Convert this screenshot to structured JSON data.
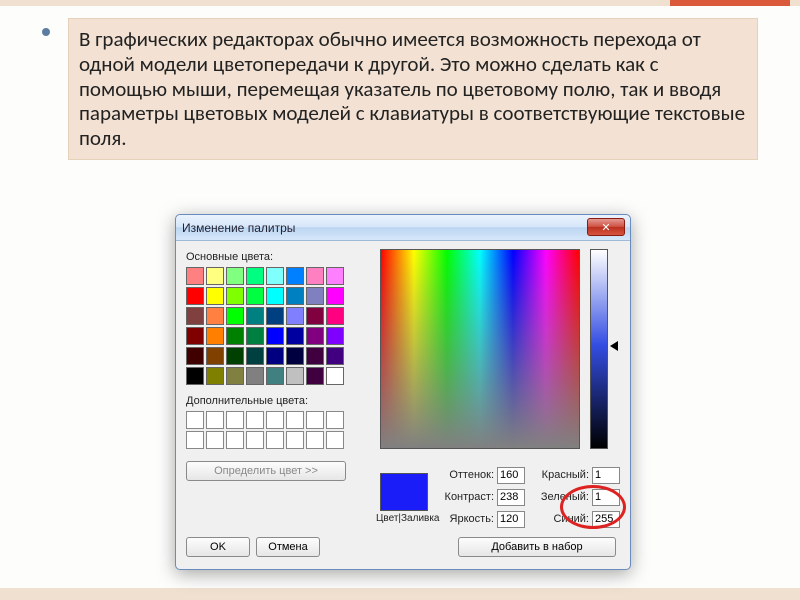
{
  "slide": {
    "paragraph": "В графических редакторах обычно имеется возможность перехода от одной модели цветопередачи к другой. Это можно сделать как с помощью мыши, перемещая указатель по цветовому полю, так и вводя параметры цветовых моделей с клавиатуры в соответствующие текстовые поля."
  },
  "dialog": {
    "title": "Изменение палитры",
    "close_glyph": "✕",
    "basic_label": "Основные цвета:",
    "basic_swatches": [
      "#ff8080",
      "#ffff80",
      "#80ff80",
      "#00ff80",
      "#80ffff",
      "#0080ff",
      "#ff80c0",
      "#ff80ff",
      "#ff0000",
      "#ffff00",
      "#80ff00",
      "#00ff40",
      "#00ffff",
      "#0080c0",
      "#8080c0",
      "#ff00ff",
      "#804040",
      "#ff8040",
      "#00ff00",
      "#008080",
      "#004080",
      "#8080ff",
      "#800040",
      "#ff0080",
      "#800000",
      "#ff8000",
      "#008000",
      "#008040",
      "#0000ff",
      "#0000a0",
      "#800080",
      "#8000ff",
      "#400000",
      "#804000",
      "#004000",
      "#004040",
      "#000080",
      "#000040",
      "#400040",
      "#400080",
      "#000000",
      "#808000",
      "#808040",
      "#808080",
      "#408080",
      "#c0c0c0",
      "#400040",
      "#ffffff"
    ],
    "custom_label": "Дополнительные цвета:",
    "define_button": "Определить цвет >>",
    "ok_button": "OK",
    "cancel_button": "Отмена",
    "preview_label": "Цвет|Заливка",
    "hue_label": "Оттенок:",
    "sat_label": "Контраст:",
    "lum_label": "Яркость:",
    "red_label": "Красный:",
    "green_label": "Зеленый:",
    "blue_label": "Синий:",
    "hue_val": "160",
    "sat_val": "238",
    "lum_val": "120",
    "red_val": "1",
    "green_val": "1",
    "blue_val": "255",
    "add_button": "Добавить в набор"
  }
}
